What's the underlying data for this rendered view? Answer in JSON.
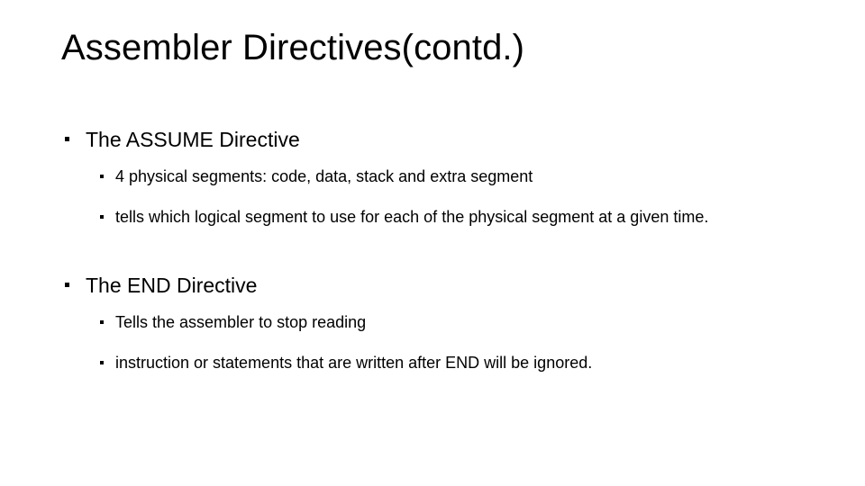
{
  "slide": {
    "title": "Assembler Directives(contd.)",
    "background_color": "#ffffff",
    "text_color": "#000000",
    "bullet_marker": "square-bullet",
    "sections": [
      {
        "heading": "The ASSUME Directive",
        "items": [
          "4 physical segments: code, data, stack and extra segment",
          "tells which logical segment to use for each of the physical segment at a given time."
        ]
      },
      {
        "heading": "The END Directive",
        "items": [
          "Tells the assembler to stop reading",
          "instruction or statements that are written after END will be ignored."
        ]
      }
    ]
  }
}
